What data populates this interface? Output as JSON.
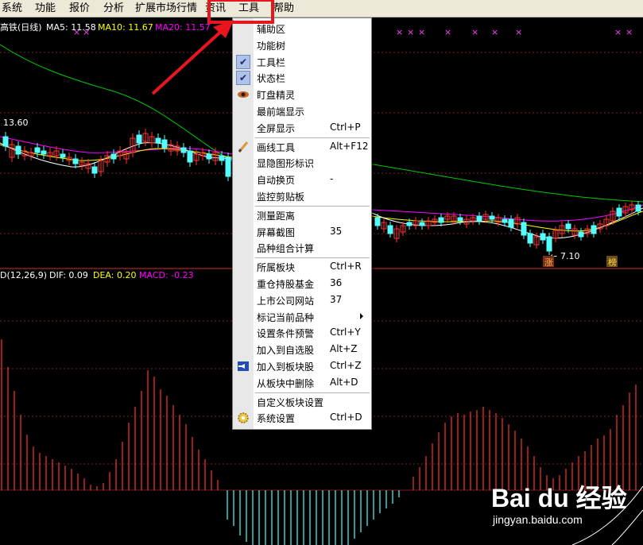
{
  "menubar": {
    "items": [
      "系统",
      "功能",
      "报价",
      "分析",
      "扩展市场行情",
      "资讯",
      "工具",
      "帮助"
    ]
  },
  "chart": {
    "title": "高铁(日线)",
    "ma5": "MA5: 11.58",
    "ma10": "MA10: 11.67",
    "ma20": "MA20: 11.57",
    "high_label": "13.60",
    "low_label": "7.10",
    "badge_zhang": "涨",
    "badge_bang": "榜",
    "macd_name": "D(12,26,9)",
    "dif": "DIF: 0.09",
    "dea": "DEA: 0.20",
    "macd": "MACD: -0.23",
    "colors": {
      "ma5": "#ffffff",
      "ma10": "#ffff00",
      "ma20": "#ff00ff",
      "ma60": "#00c800",
      "up": "#ff3232",
      "down": "#54ffff",
      "divider": "#8c1e1e"
    }
  },
  "menu": {
    "items": [
      {
        "label": "辅助区",
        "shortcut": "",
        "icon": ""
      },
      {
        "label": "功能树",
        "shortcut": "",
        "icon": ""
      },
      {
        "label": "工具栏",
        "shortcut": "",
        "icon": "check"
      },
      {
        "label": "状态栏",
        "shortcut": "",
        "icon": "check"
      },
      {
        "label": "盯盘精灵",
        "shortcut": "",
        "icon": "eye"
      },
      {
        "label": "最前端显示",
        "shortcut": "",
        "icon": ""
      },
      {
        "label": "全屏显示",
        "shortcut": "Ctrl+P",
        "icon": ""
      },
      {
        "label": "画线工具",
        "shortcut": "Alt+F12",
        "icon": "pencil"
      },
      {
        "label": "显隐图形标识",
        "shortcut": "",
        "icon": ""
      },
      {
        "label": "自动换页",
        "shortcut": "-",
        "icon": ""
      },
      {
        "label": "监控剪贴板",
        "shortcut": "",
        "icon": ""
      },
      {
        "label": "测量距离",
        "shortcut": "",
        "icon": ""
      },
      {
        "label": "屏幕截图",
        "shortcut": "35",
        "icon": ""
      },
      {
        "label": "品种组合计算",
        "shortcut": "",
        "icon": ""
      },
      {
        "label": "所属板块",
        "shortcut": "Ctrl+R",
        "icon": ""
      },
      {
        "label": "重仓持股基金",
        "shortcut": "36",
        "icon": ""
      },
      {
        "label": "上市公司网站",
        "shortcut": "37",
        "icon": ""
      },
      {
        "label": "标记当前品种",
        "shortcut": "",
        "icon": "",
        "submenu": true
      },
      {
        "label": "设置条件预警",
        "shortcut": "Ctrl+Y",
        "icon": ""
      },
      {
        "label": "加入到自选股",
        "shortcut": "Alt+Z",
        "icon": ""
      },
      {
        "label": "加入到板块股",
        "shortcut": "Ctrl+Z",
        "icon": "arrow"
      },
      {
        "label": "从板块中删除",
        "shortcut": "Alt+D",
        "icon": ""
      },
      {
        "label": "自定义板块设置",
        "shortcut": "",
        "icon": ""
      },
      {
        "label": "系统设置",
        "shortcut": "Ctrl+D",
        "icon": "gear"
      }
    ]
  },
  "watermark": {
    "logo": "Bai du 经验",
    "url": "jingyan.baidu.com"
  }
}
